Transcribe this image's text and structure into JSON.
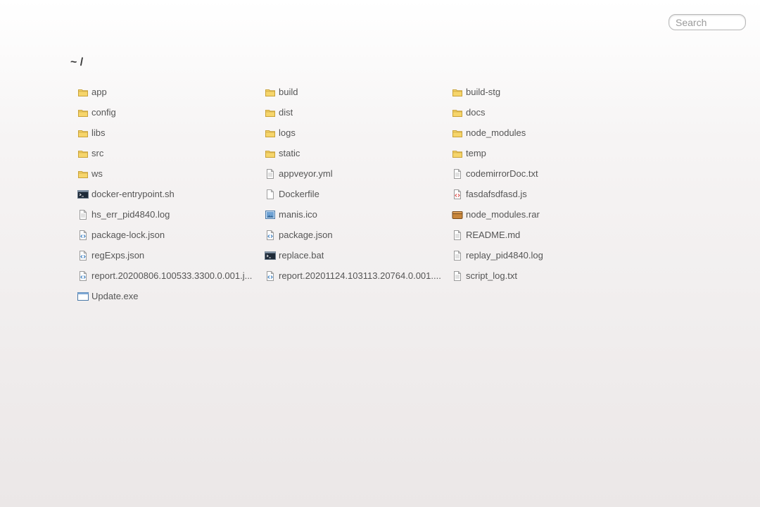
{
  "search": {
    "placeholder": "Search"
  },
  "breadcrumb": "~ /",
  "files": [
    {
      "name": "app",
      "icon": "folder-icon"
    },
    {
      "name": "build",
      "icon": "folder-icon"
    },
    {
      "name": "build-stg",
      "icon": "folder-icon"
    },
    {
      "name": "config",
      "icon": "folder-icon"
    },
    {
      "name": "dist",
      "icon": "folder-icon"
    },
    {
      "name": "docs",
      "icon": "folder-icon"
    },
    {
      "name": "libs",
      "icon": "folder-icon"
    },
    {
      "name": "logs",
      "icon": "folder-icon"
    },
    {
      "name": "node_modules",
      "icon": "folder-icon"
    },
    {
      "name": "src",
      "icon": "folder-icon"
    },
    {
      "name": "static",
      "icon": "folder-icon"
    },
    {
      "name": "temp",
      "icon": "folder-icon"
    },
    {
      "name": "ws",
      "icon": "folder-icon"
    },
    {
      "name": "appveyor.yml",
      "icon": "text-file-icon"
    },
    {
      "name": "codemirrorDoc.txt",
      "icon": "text-file-icon"
    },
    {
      "name": "docker-entrypoint.sh",
      "icon": "terminal-icon"
    },
    {
      "name": "Dockerfile",
      "icon": "blank-file-icon"
    },
    {
      "name": "fasdafsdfasd.js",
      "icon": "script-file-icon"
    },
    {
      "name": "hs_err_pid4840.log",
      "icon": "text-file-icon"
    },
    {
      "name": "manis.ico",
      "icon": "image-file-icon"
    },
    {
      "name": "node_modules.rar",
      "icon": "archive-icon"
    },
    {
      "name": "package-lock.json",
      "icon": "code-file-icon"
    },
    {
      "name": "package.json",
      "icon": "code-file-icon"
    },
    {
      "name": "README.md",
      "icon": "text-file-icon"
    },
    {
      "name": "regExps.json",
      "icon": "code-file-icon"
    },
    {
      "name": "replace.bat",
      "icon": "terminal-icon"
    },
    {
      "name": "replay_pid4840.log",
      "icon": "text-file-icon"
    },
    {
      "name": "report.20200806.100533.3300.0.001.j...",
      "icon": "code-file-icon"
    },
    {
      "name": "report.20201124.103113.20764.0.001....",
      "icon": "code-file-icon"
    },
    {
      "name": "script_log.txt",
      "icon": "text-file-icon"
    },
    {
      "name": "Update.exe",
      "icon": "application-icon"
    }
  ],
  "colors": {
    "folder_fill": "#f6d56b",
    "folder_stroke": "#c9a23a",
    "code_accent": "#3d7fc1",
    "script_accent": "#d9534f",
    "terminal_bg": "#1e2a38",
    "archive_fill": "#c8863b"
  }
}
